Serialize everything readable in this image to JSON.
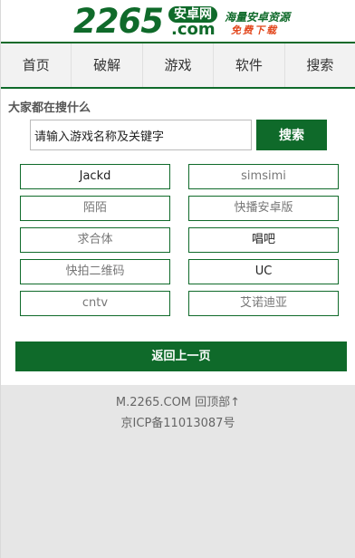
{
  "header": {
    "logo_number": "2265",
    "logo_badge": "安卓网",
    "logo_com": ".com",
    "slogan_top": "海量安卓资源",
    "slogan_bottom": "免费下载"
  },
  "nav": {
    "items": [
      "首页",
      "破解",
      "游戏",
      "软件",
      "搜索"
    ]
  },
  "search": {
    "title": "大家都在搜什么",
    "input_value": "请输入游戏名称及关键字",
    "button_label": "搜索"
  },
  "keywords": [
    {
      "label": "Jackd"
    },
    {
      "label": "simsimi"
    },
    {
      "label": "陌陌"
    },
    {
      "label": "快播安卓版"
    },
    {
      "label": "求合体"
    },
    {
      "label": "唱吧"
    },
    {
      "label": "快拍二维码"
    },
    {
      "label": "UC"
    },
    {
      "label": "cntv"
    },
    {
      "label": "艾诺迪亚"
    }
  ],
  "back_button_label": "返回上一页",
  "footer": {
    "site": "M.2265.COM",
    "top_link": "回顶部↑",
    "icp": "京ICP备11013087号"
  },
  "colors": {
    "brand_green": "#0f6a2a",
    "accent_orange": "#e2461c",
    "footer_bg": "#e6e6e6"
  }
}
